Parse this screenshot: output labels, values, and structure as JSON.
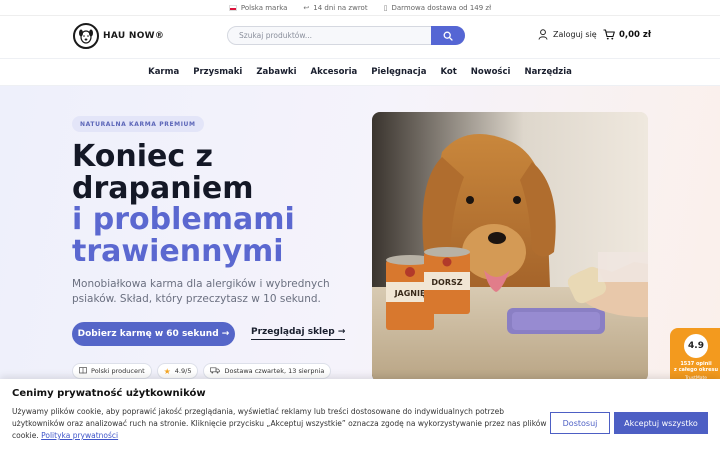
{
  "topbar": {
    "items": [
      {
        "icon": "flag-poland-icon",
        "label": "Polska marka"
      },
      {
        "icon": "return-arrow-icon",
        "label": "14 dni na zwrot"
      },
      {
        "icon": "truck-icon",
        "label": "Darmowa dostawa od 149 zł"
      }
    ]
  },
  "header": {
    "logo_text": "HAU NOW®",
    "search_placeholder": "Szukaj produktów...",
    "login_label": "Zaloguj się",
    "cart_total": "0,00 zł"
  },
  "nav": {
    "items": [
      "Karma",
      "Przysmaki",
      "Zabawki",
      "Akcesoria",
      "Pielęgnacja",
      "Kot",
      "Nowości",
      "Narzędzia"
    ]
  },
  "hero": {
    "badge": "NATURALNA KARMA PREMIUM",
    "title_line1": "Koniec z",
    "title_line2": "drapaniem",
    "title_accent1": "i problemami",
    "title_accent2": "trawiennymi",
    "subtitle": "Monobiałkowa karma dla alergików i wybrednych psiaków. Skład, który przeczytasz w 10 sekund.",
    "cta_primary": "Dobierz karmę w 60 sekund →",
    "cta_secondary": "Przeglądaj sklep →",
    "chips": [
      {
        "icon": "book-icon",
        "label": "Polski producent"
      },
      {
        "icon": "star-icon",
        "label": "4.9/5"
      },
      {
        "icon": "truck-icon",
        "label": "Dostawa czwartek, 13 sierpnia"
      }
    ],
    "image_can_labels": [
      "JAGNIĘ",
      "DORSZ"
    ]
  },
  "trust_badge": {
    "rating": "4.9",
    "reviews": "1537 opinii",
    "period": "z całego okresu",
    "brand": "TrustMate"
  },
  "cookie": {
    "title": "Cenimy prywatność użytkowników",
    "text": "Używamy plików cookie, aby poprawić jakość przeglądania, wyświetlać reklamy lub treści dostosowane do indywidualnych potrzeb użytkowników oraz analizować ruch na stronie. Kliknięcie przycisku „Akceptuj wszystkie” oznacza zgodę na wykorzystywanie przez nas plików cookie.",
    "policy_link": "Polityka prywatności",
    "decline_label": "Dostosuj",
    "accept_label": "Akceptuj wszystko"
  },
  "colors": {
    "accent": "#5566c8",
    "accent_text": "#5b68d0",
    "trust_orange": "#f39a1e"
  }
}
